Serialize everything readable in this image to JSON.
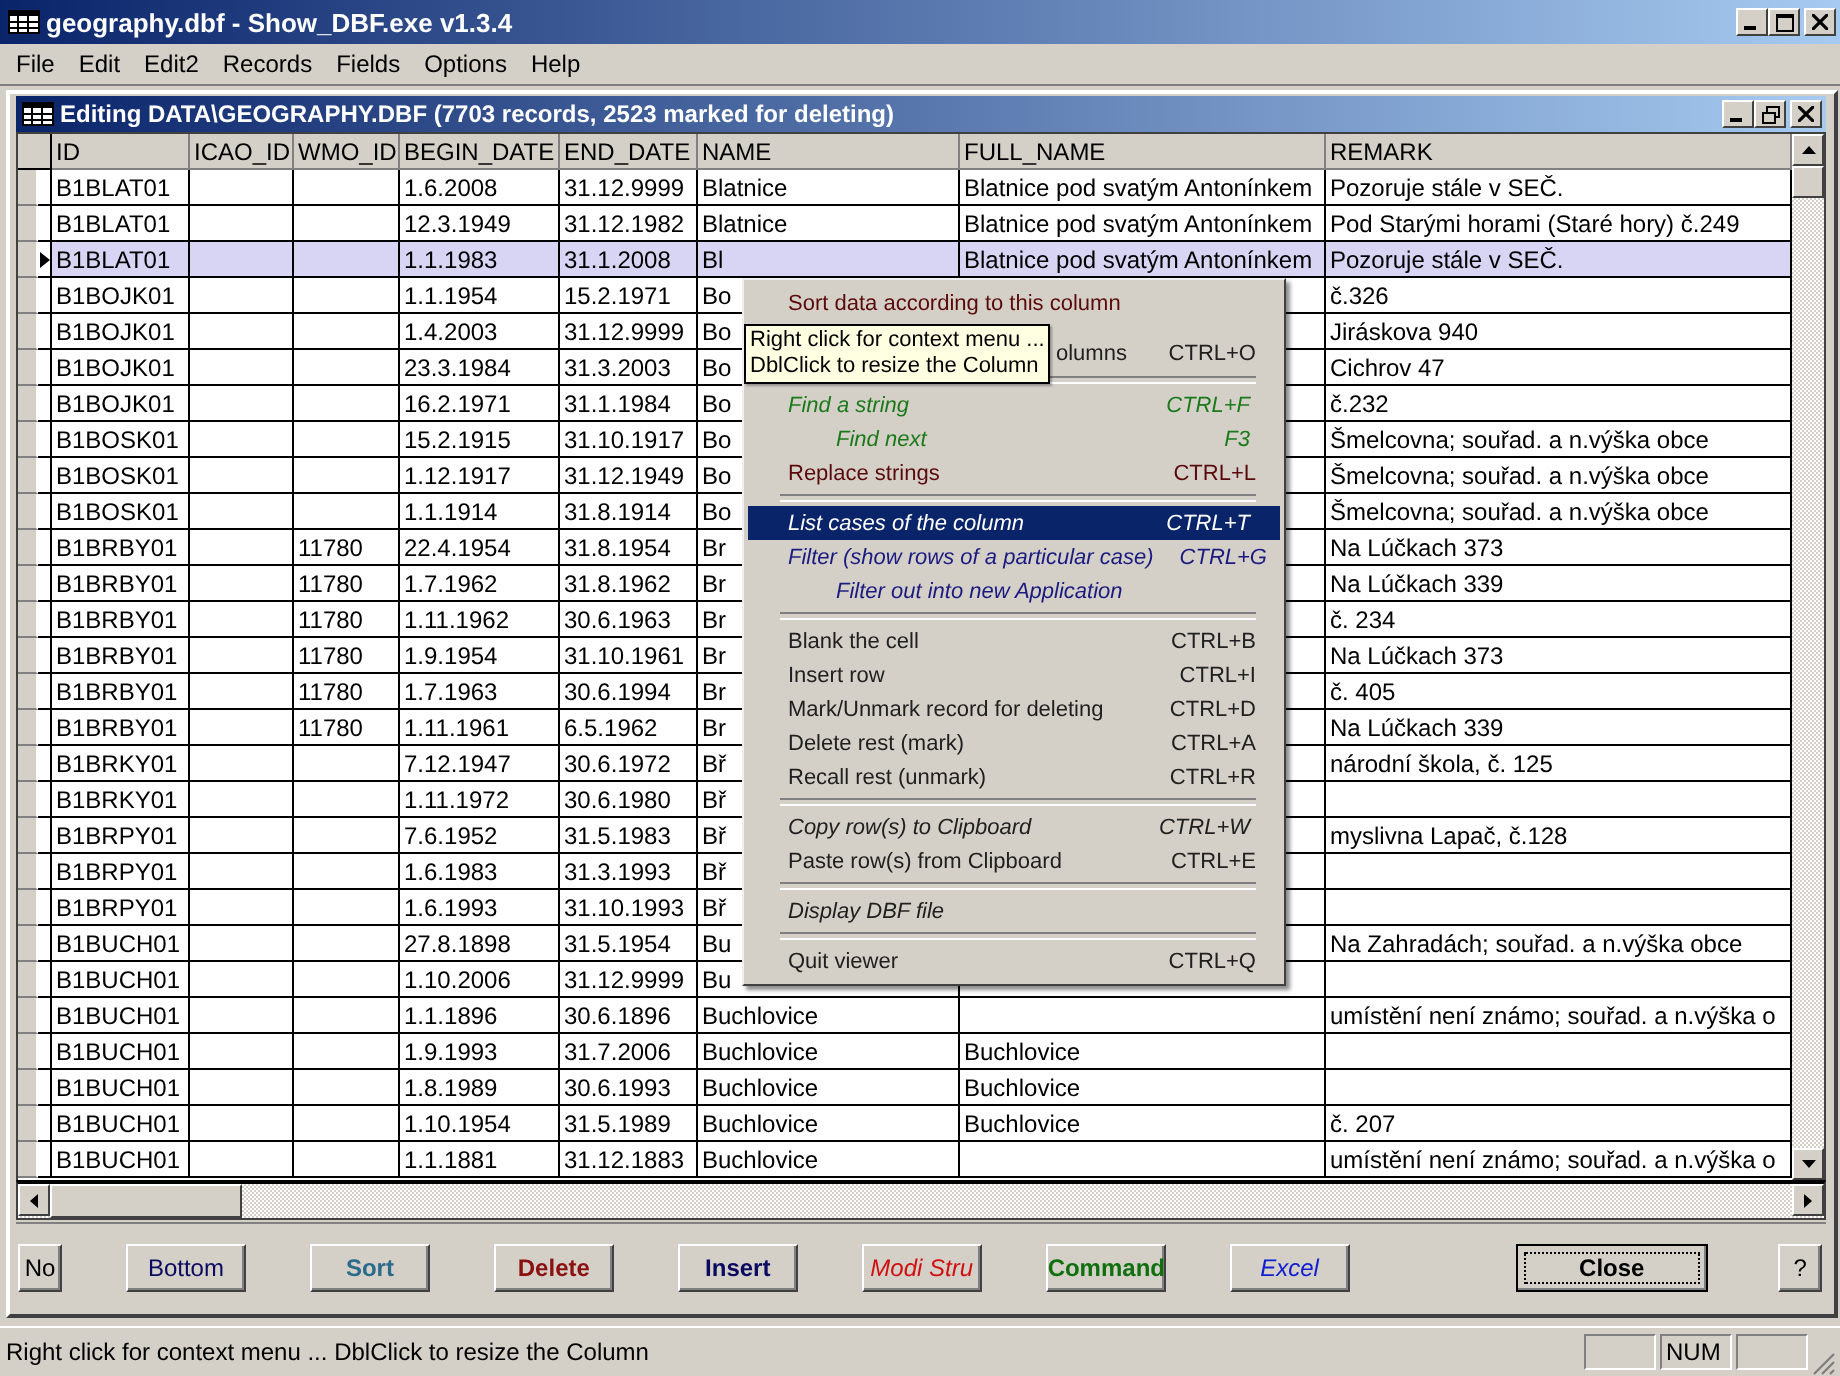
{
  "window": {
    "title": "geography.dbf - Show_DBF.exe  v1.3.4"
  },
  "menu_bar": [
    "File",
    "Edit",
    "Edit2",
    "Records",
    "Fields",
    "Options",
    "Help"
  ],
  "child_window": {
    "title": "Editing  DATA\\GEOGRAPHY.DBF   (7703 records, 2523 marked for deleting)"
  },
  "table": {
    "columns": [
      "ID",
      "ICAO_ID",
      "WMO_ID",
      "BEGIN_DATE",
      "END_DATE",
      "NAME",
      "FULL_NAME",
      "REMARK"
    ],
    "rows": [
      {
        "selected": false,
        "cells": [
          "B1BLAT01",
          null,
          null,
          "1.6.2008",
          "31.12.9999",
          "Blatnice",
          "Blatnice pod svatým Antonínkem",
          "Pozoruje stále v SEČ."
        ]
      },
      {
        "selected": false,
        "cells": [
          "B1BLAT01",
          null,
          null,
          "12.3.1949",
          "31.12.1982",
          "Blatnice",
          "Blatnice pod svatým Antonínkem",
          "Pod Starými horami (Staré hory) č.249"
        ]
      },
      {
        "selected": true,
        "cells": [
          "B1BLAT01",
          null,
          null,
          "1.1.1983",
          "31.1.2008",
          "Bl",
          "Blatnice pod svatým Antonínkem",
          "Pozoruje stále v SEČ."
        ]
      },
      {
        "selected": false,
        "cells": [
          "B1BOJK01",
          null,
          null,
          "1.1.1954",
          "15.2.1971",
          "Bo",
          null,
          "č.326"
        ]
      },
      {
        "selected": false,
        "cells": [
          "B1BOJK01",
          null,
          null,
          "1.4.2003",
          "31.12.9999",
          "Bo",
          null,
          "Jiráskova 940"
        ]
      },
      {
        "selected": false,
        "cells": [
          "B1BOJK01",
          null,
          null,
          "23.3.1984",
          "31.3.2003",
          "Bo",
          null,
          "Cichrov 47"
        ]
      },
      {
        "selected": false,
        "cells": [
          "B1BOJK01",
          null,
          null,
          "16.2.1971",
          "31.1.1984",
          "Bo",
          null,
          "č.232"
        ]
      },
      {
        "selected": false,
        "cells": [
          "B1BOSK01",
          null,
          null,
          "15.2.1915",
          "31.10.1917",
          "Bo",
          null,
          "Šmelcovna;  souřad. a n.výška obce"
        ]
      },
      {
        "selected": false,
        "cells": [
          "B1BOSK01",
          null,
          null,
          "1.12.1917",
          "31.12.1949",
          "Bo",
          null,
          "Šmelcovna;  souřad. a n.výška obce"
        ]
      },
      {
        "selected": false,
        "cells": [
          "B1BOSK01",
          null,
          null,
          "1.1.1914",
          "31.8.1914",
          "Bo",
          null,
          "Šmelcovna;  souřad. a n.výška obce"
        ]
      },
      {
        "selected": false,
        "cells": [
          "B1BRBY01",
          null,
          "11780",
          "22.4.1954",
          "31.8.1954",
          "Br",
          null,
          "Na Lúčkach 373"
        ]
      },
      {
        "selected": false,
        "cells": [
          "B1BRBY01",
          null,
          "11780",
          "1.7.1962",
          "31.8.1962",
          "Br",
          null,
          "Na Lúčkach 339"
        ]
      },
      {
        "selected": false,
        "cells": [
          "B1BRBY01",
          null,
          "11780",
          "1.11.1962",
          "30.6.1963",
          "Br",
          null,
          "č. 234"
        ]
      },
      {
        "selected": false,
        "cells": [
          "B1BRBY01",
          null,
          "11780",
          "1.9.1954",
          "31.10.1961",
          "Br",
          null,
          "Na Lúčkach 373"
        ]
      },
      {
        "selected": false,
        "cells": [
          "B1BRBY01",
          null,
          "11780",
          "1.7.1963",
          "30.6.1994",
          "Br",
          null,
          "č. 405"
        ]
      },
      {
        "selected": false,
        "cells": [
          "B1BRBY01",
          null,
          "11780",
          "1.11.1961",
          "6.5.1962",
          "Br",
          null,
          "Na Lúčkach 339"
        ]
      },
      {
        "selected": false,
        "cells": [
          "B1BRKY01",
          null,
          null,
          "7.12.1947",
          "30.6.1972",
          "Bř",
          null,
          "národní škola, č. 125"
        ]
      },
      {
        "selected": false,
        "cells": [
          "B1BRKY01",
          null,
          null,
          "1.11.1972",
          "30.6.1980",
          "Bř",
          null,
          null
        ]
      },
      {
        "selected": false,
        "cells": [
          "B1BRPY01",
          null,
          null,
          "7.6.1952",
          "31.5.1983",
          "Bř",
          null,
          "myslivna Lapač, č.128"
        ]
      },
      {
        "selected": false,
        "cells": [
          "B1BRPY01",
          null,
          null,
          "1.6.1983",
          "31.3.1993",
          "Bř",
          null,
          null
        ]
      },
      {
        "selected": false,
        "cells": [
          "B1BRPY01",
          null,
          null,
          "1.6.1993",
          "31.10.1993",
          "Bř",
          null,
          null
        ]
      },
      {
        "selected": false,
        "cells": [
          "B1BUCH01",
          null,
          null,
          "27.8.1898",
          "31.5.1954",
          "Bu",
          null,
          "Na Zahradách;  souřad. a n.výška obce"
        ]
      },
      {
        "selected": false,
        "cells": [
          "B1BUCH01",
          null,
          null,
          "1.10.2006",
          "31.12.9999",
          "Bu",
          null,
          null
        ]
      },
      {
        "selected": false,
        "cells": [
          "B1BUCH01",
          null,
          null,
          "1.1.1896",
          "30.6.1896",
          "Buchlovice",
          null,
          "umístění není známo;  souřad. a n.výška o"
        ]
      },
      {
        "selected": false,
        "cells": [
          "B1BUCH01",
          null,
          null,
          "1.9.1993",
          "31.7.2006",
          "Buchlovice",
          "Buchlovice",
          null
        ]
      },
      {
        "selected": false,
        "cells": [
          "B1BUCH01",
          null,
          null,
          "1.8.1989",
          "30.6.1993",
          "Buchlovice",
          "Buchlovice",
          null
        ]
      },
      {
        "selected": false,
        "cells": [
          "B1BUCH01",
          null,
          null,
          "1.10.1954",
          "31.5.1989",
          "Buchlovice",
          "Buchlovice",
          "č. 207"
        ]
      },
      {
        "selected": false,
        "cells": [
          "B1BUCH01",
          null,
          null,
          "1.1.1881",
          "31.12.1883",
          "Buchlovice",
          null,
          "umístění není známo;  souřad. a n.výška o"
        ]
      }
    ]
  },
  "context_menu": {
    "items": [
      {
        "kind": "item",
        "label": "Sort data according to this column",
        "color": "#5a0a0a",
        "italic": false,
        "indented": false,
        "selected": false
      },
      {
        "kind": "covered",
        "label": "olumns",
        "shortcut": "CTRL+O",
        "color": "#202020",
        "italic": false,
        "indented": false,
        "selected": false
      },
      {
        "kind": "separator"
      },
      {
        "kind": "item",
        "label": "Find a string",
        "shortcut": "CTRL+F",
        "color": "#1a7a1a",
        "italic": true,
        "indented": false,
        "selected": false
      },
      {
        "kind": "item",
        "label": "Find next",
        "shortcut": "F3",
        "color": "#1a7a1a",
        "italic": true,
        "indented": true,
        "selected": false
      },
      {
        "kind": "item",
        "label": "Replace strings",
        "shortcut": "CTRL+L",
        "color": "#5a0a0a",
        "italic": false,
        "indented": false,
        "selected": false
      },
      {
        "kind": "separator"
      },
      {
        "kind": "item",
        "label": "List cases of the column",
        "shortcut": "CTRL+T",
        "color": "#ffffff",
        "italic": true,
        "indented": false,
        "selected": true
      },
      {
        "kind": "item",
        "label": "Filter (show rows of a particular case)",
        "shortcut": "CTRL+G",
        "color": "#1a1a80",
        "italic": true,
        "indented": false,
        "selected": false
      },
      {
        "kind": "item",
        "label": "Filter out  into new Application",
        "color": "#1a1a80",
        "italic": true,
        "indented": true,
        "selected": false
      },
      {
        "kind": "separator"
      },
      {
        "kind": "item",
        "label": "Blank the cell",
        "shortcut": "CTRL+B",
        "color": "#202020",
        "italic": false,
        "indented": false,
        "selected": false
      },
      {
        "kind": "item",
        "label": "Insert row",
        "shortcut": "CTRL+I",
        "color": "#202020",
        "italic": false,
        "indented": false,
        "selected": false
      },
      {
        "kind": "item",
        "label": "Mark/Unmark record for deleting",
        "shortcut": "CTRL+D",
        "color": "#202020",
        "italic": false,
        "indented": false,
        "selected": false
      },
      {
        "kind": "item",
        "label": "Delete rest (mark)",
        "shortcut": "CTRL+A",
        "color": "#202020",
        "italic": false,
        "indented": false,
        "selected": false
      },
      {
        "kind": "item",
        "label": "Recall rest (unmark)",
        "shortcut": "CTRL+R",
        "color": "#202020",
        "italic": false,
        "indented": false,
        "selected": false
      },
      {
        "kind": "separator"
      },
      {
        "kind": "item",
        "label": "Copy row(s) to Clipboard",
        "shortcut": "CTRL+W",
        "color": "#202020",
        "italic": true,
        "indented": false,
        "selected": false
      },
      {
        "kind": "item",
        "label": "Paste row(s) from Clipboard",
        "shortcut": "CTRL+E",
        "color": "#202020",
        "italic": false,
        "indented": false,
        "selected": false
      },
      {
        "kind": "separator"
      },
      {
        "kind": "item",
        "label": "Display DBF file",
        "color": "#202020",
        "italic": true,
        "indented": false,
        "selected": false
      },
      {
        "kind": "separator"
      },
      {
        "kind": "item",
        "label": "Quit viewer",
        "shortcut": "CTRL+Q",
        "color": "#202020",
        "italic": false,
        "indented": false,
        "selected": false
      }
    ]
  },
  "tooltip": [
    "Right click for context menu ...",
    "DblClick to resize the Column"
  ],
  "buttons": [
    {
      "label": "No",
      "color": "#000000",
      "bold": false,
      "italic": false,
      "focused": false
    },
    {
      "label": "Bottom",
      "color": "#0a0a60",
      "bold": false,
      "italic": false,
      "focused": false
    },
    {
      "label": "Sort",
      "color": "#2a6a8a",
      "bold": true,
      "italic": false,
      "focused": false
    },
    {
      "label": "Delete",
      "color": "#8b1010",
      "bold": true,
      "italic": false,
      "focused": false
    },
    {
      "label": "Insert",
      "color": "#0a0a60",
      "bold": true,
      "italic": false,
      "focused": false
    },
    {
      "label": "Modi Stru",
      "color": "#d01010",
      "bold": false,
      "italic": true,
      "focused": false
    },
    {
      "label": "Command",
      "color": "#107010",
      "bold": true,
      "italic": false,
      "focused": false
    },
    {
      "label": "Excel",
      "color": "#1020d0",
      "bold": false,
      "italic": true,
      "focused": false
    },
    {
      "label": "Close",
      "color": "#000000",
      "bold": true,
      "italic": false,
      "focused": true
    },
    {
      "label": "?",
      "color": "#000000",
      "bold": false,
      "italic": false,
      "focused": false
    }
  ],
  "status_bar": {
    "text": "Right click for context menu ...  DblClick to resize the Column",
    "panels": [
      "NUM"
    ]
  }
}
